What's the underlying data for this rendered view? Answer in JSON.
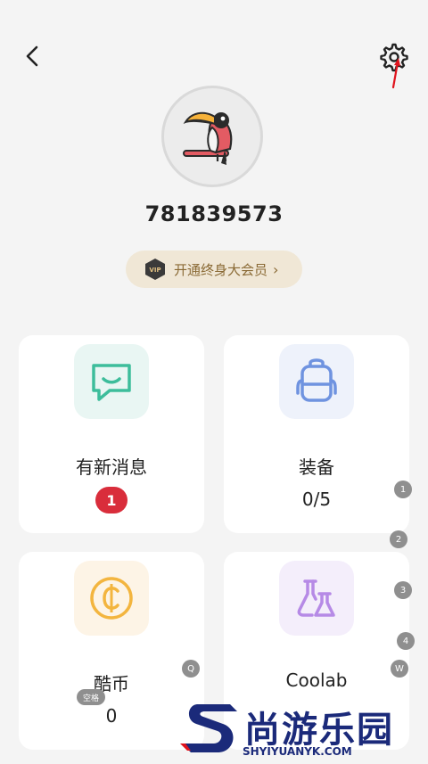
{
  "header": {
    "back_icon": "chevron-left-icon",
    "settings_icon": "gear-icon"
  },
  "profile": {
    "avatar": "toucan-avatar",
    "username": "781839573"
  },
  "vip": {
    "label": "开通终身大会员",
    "badge_text": "VIP",
    "chevron": "›"
  },
  "cards": [
    {
      "key": "messages",
      "title": "有新消息",
      "value": "1",
      "icon": "message-icon",
      "tile_color": "#e9f6f3",
      "icon_color": "#3dbd9b"
    },
    {
      "key": "equipment",
      "title": "装备",
      "value": "0/5",
      "icon": "backpack-icon",
      "tile_color": "#eef2fb",
      "icon_color": "#6f93e0"
    },
    {
      "key": "coins",
      "title": "酷币",
      "value": "0",
      "icon": "coin-icon",
      "tile_color": "#fdf4e6",
      "icon_color": "#f3b53f"
    },
    {
      "key": "coolab",
      "title": "Coolab",
      "value": "",
      "icon": "flask-icon",
      "tile_color": "#f4eefb",
      "icon_color": "#b68ae6"
    }
  ],
  "overlay_markers": [
    "1",
    "2",
    "3",
    "4",
    "W",
    "Q",
    "空格"
  ],
  "watermark": {
    "brand": "尚游乐园",
    "url": "SHYIYUANYK.COM"
  }
}
